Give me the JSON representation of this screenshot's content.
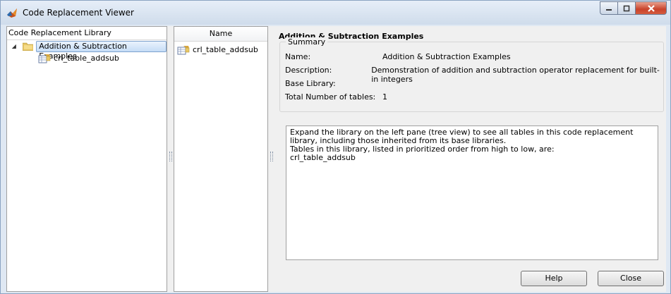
{
  "window": {
    "title": "Code Replacement Viewer",
    "app_icon": "matlab-logo-icon",
    "controls": [
      "minimize-icon",
      "maximize-icon",
      "close-icon"
    ]
  },
  "left_pane": {
    "header": "Code Replacement Library",
    "tree": {
      "root_label": "Addition & Subtraction Examples",
      "root_icon": "folder-icon",
      "root_expanded": true,
      "children": [
        {
          "label": "crl_table_addsub",
          "icon": "table-icon"
        }
      ]
    }
  },
  "middle_pane": {
    "column_header": "Name",
    "items": [
      {
        "label": "crl_table_addsub",
        "icon": "table-icon"
      }
    ]
  },
  "details": {
    "title": "Addition & Subtraction Examples",
    "summary_label": "Summary",
    "summary": [
      {
        "key": "Name:",
        "value": "Addition & Subtraction Examples"
      },
      {
        "key": "Description:",
        "value": "Demonstration of addition and subtraction operator replacement for built-in integers"
      },
      {
        "key": "Base Library:",
        "value": ""
      },
      {
        "key": "Total Number of tables:",
        "value": "1"
      }
    ],
    "text_lines": [
      "Expand the library on the left pane (tree view) to see all tables in this code replacement library, including those inherited from its base libraries.",
      "Tables in this library, listed in prioritized order from high to low, are:",
      "crl_table_addsub"
    ]
  },
  "buttons": {
    "help": "Help",
    "close": "Close"
  },
  "colors": {
    "selection_fill": "#c5dcf6",
    "selection_border": "#7da2ce",
    "close_button": "#c9432b",
    "folder": "#e8c766"
  }
}
